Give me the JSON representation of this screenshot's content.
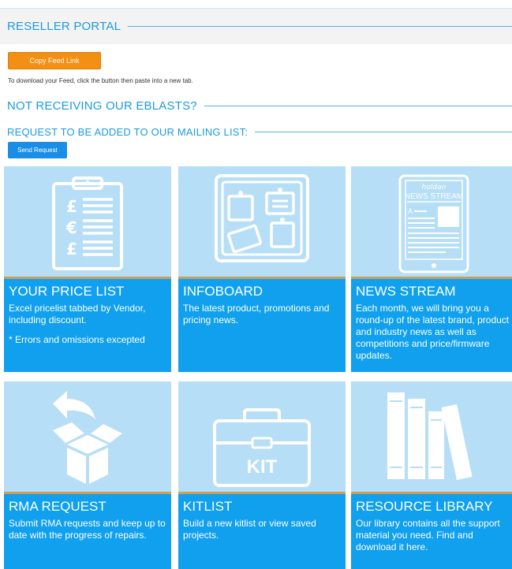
{
  "header": {
    "title": "RESELLER PORTAL"
  },
  "feed": {
    "button_label": "Copy Feed Link",
    "instructions": "To download your Feed, click the button then paste into a new tab."
  },
  "eblasts": {
    "heading": "NOT RECEIVING OUR EBLASTS?",
    "subheading": "REQUEST TO BE ADDED TO OUR MAILING LIST:",
    "button_label": "Send Request"
  },
  "tiles": [
    {
      "title": "YOUR PRICE LIST",
      "desc": "Excel pricelist tabbed by Vendor, including discount.",
      "note": "* Errors and omissions excepted",
      "icon": "clipboard-price-icon"
    },
    {
      "title": "INFOBOARD",
      "desc": "The latest product, promotions and pricing news.",
      "note": "",
      "icon": "pinboard-icon"
    },
    {
      "title": "NEWS STREAM",
      "desc": "Each month, we will bring you a round-up of the latest brand, product and industry news as well as competitions and price/firmware updates.",
      "note": "",
      "icon": "tablet-news-icon",
      "icon_brand": "holdan",
      "icon_caption": "NEWS STREAM",
      "icon_letter": "A"
    },
    {
      "title": "RMA REQUEST",
      "desc": "Submit RMA requests and keep up to date with the progress of repairs.",
      "note": "",
      "icon": "return-box-icon"
    },
    {
      "title": "KITLIST",
      "desc": "Build a new kitlist or view saved projects.",
      "note": "",
      "icon": "toolbox-icon",
      "icon_label": "KIT"
    },
    {
      "title": "RESOURCE LIBRARY",
      "desc": "Our library contains all the support material you need. Find and download it here.",
      "note": "",
      "icon": "books-icon"
    }
  ],
  "colors": {
    "accent": "#1b9be0",
    "orange_button": "#f39014",
    "blue_button": "#1a8ee6",
    "tile_image_bg": "#b7def7",
    "tile_body_bg": "#10a0ee"
  }
}
